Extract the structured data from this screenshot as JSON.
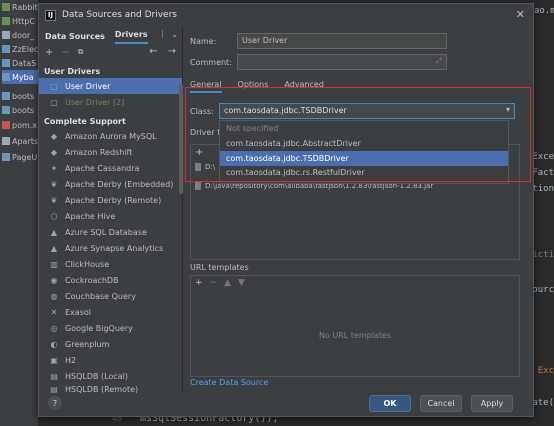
{
  "window": {
    "title": "Data Sources and Drivers"
  },
  "ide_project_items": [
    "RabbitMQ",
    "HttpC",
    "door_",
    "ZzElec",
    "DataS",
    "Myba",
    "boots",
    "boots",
    "pom.x",
    "Aparts",
    "PageU"
  ],
  "ide_code": {
    "lines": [
      "ao.m",
      "s Exce",
      "onFact",
      "ation",
      "tricti",
      "esourc",
      "ws Exc",
      "late(",
      "e("
    ],
    "bottom_line": "msSqlSessionFactory());",
    "line_number": "48"
  },
  "left_panel": {
    "tabs": [
      {
        "label": "Data Sources"
      },
      {
        "label": "Drivers"
      }
    ],
    "sections": {
      "user": "User Drivers",
      "complete": "Complete Support"
    },
    "user_drivers": [
      {
        "label": "User Driver",
        "selected": true
      },
      {
        "label": "User Driver [2]",
        "selected": false
      }
    ],
    "drivers": [
      "Amazon Aurora MySQL",
      "Amazon Redshift",
      "Apache Cassandra",
      "Apache Derby (Embedded)",
      "Apache Derby (Remote)",
      "Apache Hive",
      "Azure SQL Database",
      "Azure Synapse Analytics",
      "ClickHouse",
      "CockroachDB",
      "Couchbase Query",
      "Exasol",
      "Google BigQuery",
      "Greenplum",
      "H2",
      "HSQLDB (Local)",
      "HSQLDB (Remote)"
    ]
  },
  "form": {
    "name_label": "Name:",
    "name_value": "User Driver",
    "comment_label": "Comment:",
    "comment_value": "",
    "tabs": [
      "General",
      "Options",
      "Advanced"
    ],
    "class_label": "Class:",
    "class_value": "com.taosdata.jdbc.TSDBDriver",
    "class_options": [
      "Not specified",
      "com.taosdata.jdbc.AbstractDriver",
      "com.taosdata.jdbc.TSDBDriver",
      "com.taosdata.jdbc.rs.RestfulDriver"
    ],
    "driver_files_label": "Driver f",
    "driver_files": [
      "D:\\",
      "D:\\java\\repository\\com\\alibaba\\fastjson\\1.2.83\\fastjson-1.2.83.jar"
    ],
    "url_templates_label": "URL templates",
    "no_url_text": "No URL templates",
    "create_link": "Create Data Source"
  },
  "buttons": {
    "ok": "OK",
    "cancel": "Cancel",
    "apply": "Apply",
    "help": "?"
  },
  "colors": {
    "accent": "#4b6eaf",
    "highlight": "#e0282e",
    "link": "#589df6"
  }
}
